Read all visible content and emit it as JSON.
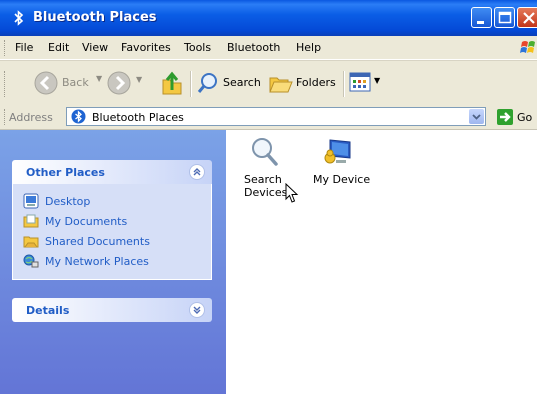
{
  "window": {
    "title": "Bluetooth Places",
    "icon": "bluetooth-icon",
    "title_bar_color": "#0a58e0"
  },
  "menu": {
    "items": [
      "File",
      "Edit",
      "View",
      "Favorites",
      "Tools",
      "Bluetooth",
      "Help"
    ]
  },
  "toolbar": {
    "back_label": "Back",
    "search_label": "Search",
    "folders_label": "Folders"
  },
  "address": {
    "label": "Address",
    "value": "Bluetooth Places",
    "go_label": "Go"
  },
  "sidebar": {
    "other_places": {
      "title": "Other Places",
      "items": [
        {
          "label": "Desktop",
          "icon": "desktop-icon"
        },
        {
          "label": "My Documents",
          "icon": "my-documents-icon"
        },
        {
          "label": "Shared Documents",
          "icon": "shared-folder-icon"
        },
        {
          "label": "My Network Places",
          "icon": "network-places-icon"
        }
      ]
    },
    "details": {
      "title": "Details"
    }
  },
  "content": {
    "items": [
      {
        "label_line1": "Search",
        "label_line2": "Devices",
        "icon": "magnifier-icon"
      },
      {
        "label_line1": "My Device",
        "label_line2": "",
        "icon": "computer-icon"
      }
    ]
  }
}
